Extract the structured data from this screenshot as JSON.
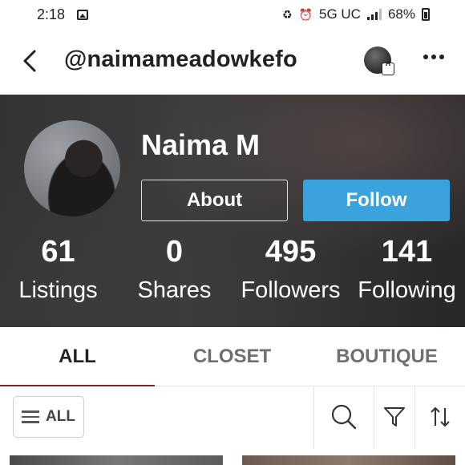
{
  "status_bar": {
    "time": "2:18",
    "network": "5G UC",
    "battery": "68%"
  },
  "header": {
    "username": "@naimameadowkefo",
    "back_icon": "chevron-left-icon",
    "more_icon": "more-dots-icon"
  },
  "profile": {
    "display_name": "Naima M",
    "about_label": "About",
    "follow_label": "Follow",
    "follow_color": "#3aa2dc",
    "stats": [
      {
        "count": "61",
        "label": "Listings"
      },
      {
        "count": "0",
        "label": "Shares"
      },
      {
        "count": "495",
        "label": "Followers"
      },
      {
        "count": "141",
        "label": "Following"
      }
    ]
  },
  "tabs": [
    {
      "label": "ALL",
      "active": true
    },
    {
      "label": "CLOSET",
      "active": false
    },
    {
      "label": "BOUTIQUE",
      "active": false
    }
  ],
  "accent_color": "#7b2430",
  "filter_bar": {
    "all_label": "ALL",
    "icons": [
      "search-icon",
      "filter-icon",
      "sort-icon"
    ]
  }
}
